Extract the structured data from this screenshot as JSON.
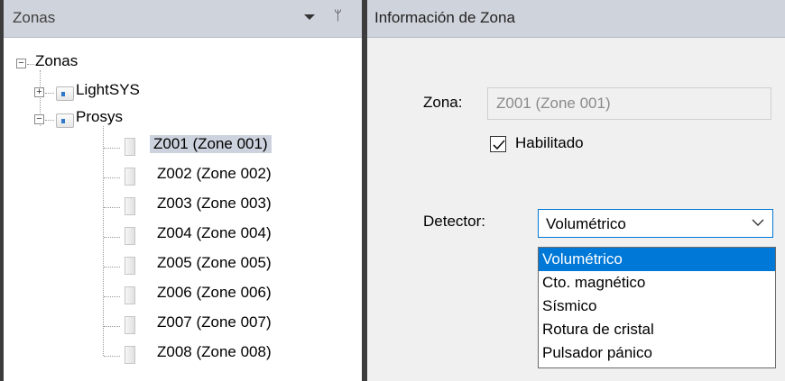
{
  "left_panel": {
    "title": "Zonas",
    "tree": {
      "root": "Zonas",
      "expand_plus": "+",
      "expand_minus": "−",
      "groups": [
        "LightSYS",
        "Prosys"
      ],
      "zones": [
        "Z001 (Zone 001)",
        "Z002 (Zone 002)",
        "Z003 (Zone 003)",
        "Z004 (Zone 004)",
        "Z005 (Zone 005)",
        "Z006 (Zone 006)",
        "Z007 (Zone 007)",
        "Z008 (Zone 008)"
      ],
      "selected_zone": "Z001 (Zone 001)"
    },
    "pin_glyph": "ᛘ"
  },
  "right_panel": {
    "title": "Información de Zona",
    "zona_label": "Zona:",
    "zona_value": "Z001 (Zone 001)",
    "habilitado_label": "Habilitado",
    "habilitado_checked": true,
    "detector_label": "Detector:",
    "detector_selected": "Volumétrico",
    "detector_options": [
      "Volumétrico",
      "Cto. magnético",
      "Sísmico",
      "Rotura de cristal",
      "Pulsador pánico"
    ],
    "highlighted_option": "Volumétrico"
  },
  "colors": {
    "header_bg": "#cfd3db",
    "selection_bg": "#cdd3de",
    "accent": "#0078d7",
    "splitter": "#3c3c3c"
  }
}
